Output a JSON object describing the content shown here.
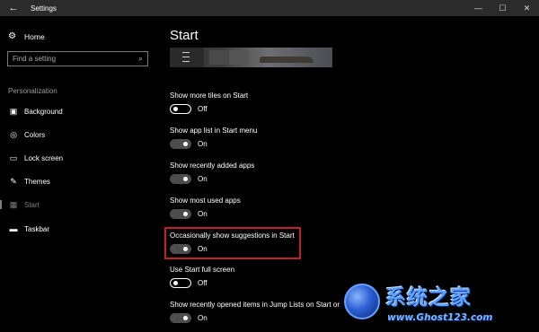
{
  "window": {
    "title": "Settings",
    "back_glyph": "←",
    "minimize_glyph": "—",
    "maximize_glyph": "☐",
    "close_glyph": "✕"
  },
  "sidebar": {
    "home_label": "Home",
    "search_placeholder": "Find a setting",
    "section_header": "Personalization",
    "items": [
      {
        "label": "Background",
        "icon": "background-icon"
      },
      {
        "label": "Colors",
        "icon": "colors-icon"
      },
      {
        "label": "Lock screen",
        "icon": "lock-screen-icon"
      },
      {
        "label": "Themes",
        "icon": "themes-icon"
      },
      {
        "label": "Start",
        "icon": "start-icon",
        "active": true
      },
      {
        "label": "Taskbar",
        "icon": "taskbar-icon"
      }
    ]
  },
  "main": {
    "title": "Start",
    "settings": [
      {
        "label": "Show more tiles on Start",
        "state": "Off",
        "on": false
      },
      {
        "label": "Show app list in Start menu",
        "state": "On",
        "on": true
      },
      {
        "label": "Show recently added apps",
        "state": "On",
        "on": true
      },
      {
        "label": "Show most used apps",
        "state": "On",
        "on": true
      },
      {
        "label": "Occasionally show suggestions in Start",
        "state": "On",
        "on": true,
        "highlighted": true
      },
      {
        "label": "Use Start full screen",
        "state": "Off",
        "on": false
      },
      {
        "label": "Show recently opened items in Jump Lists on Start or",
        "state": "On",
        "on": true
      }
    ],
    "partial_text": "tas"
  },
  "watermark": {
    "text_cn": "系统之家",
    "url": "www.Ghost123.com"
  },
  "colors": {
    "background": "#000000",
    "titlebar": "#2b2b2b",
    "highlight_border": "#c11f2c",
    "toggle_on": "#4d4d4d"
  }
}
